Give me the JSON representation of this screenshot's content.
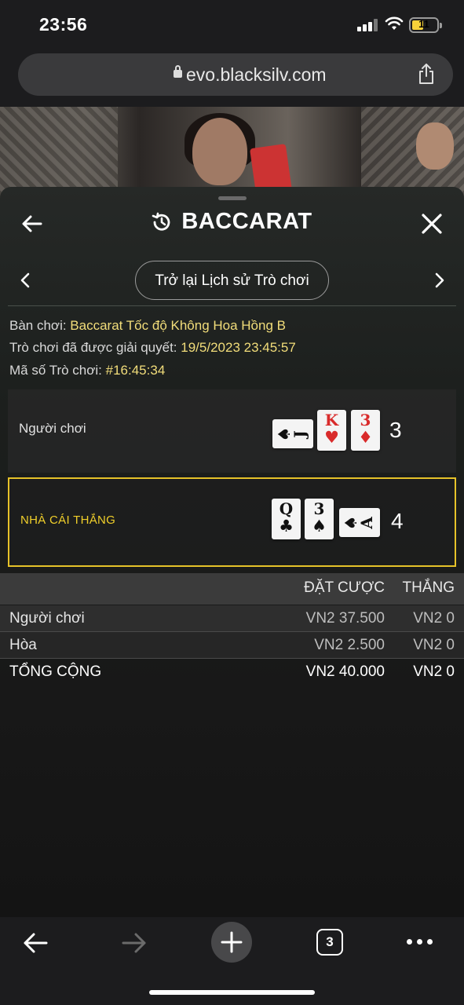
{
  "status_bar": {
    "time": "23:56",
    "battery": "11"
  },
  "browser": {
    "url": "evo.blacksilv.com",
    "open_tabs": "3"
  },
  "header": {
    "title": "BACCARAT"
  },
  "nav": {
    "back_to_history": "Trở lại Lịch sử Trò chơi"
  },
  "game_info": {
    "table_label": "Bàn chơi: ",
    "table_value": "Baccarat Tốc độ Không Hoa Hồng B",
    "resolved_label": "Trò chơi đã được giải quyết: ",
    "resolved_value": "19/5/2023 23:45:57",
    "id_label": "Mã số Trò chơi: ",
    "id_value": "#16:45:34"
  },
  "player_hand": {
    "label": "Người chơi",
    "score": "3",
    "cards": [
      {
        "rank": "J",
        "suit": "♠",
        "color": "#111111"
      },
      {
        "rank": "K",
        "suit": "♥",
        "color": "#d92b2b"
      },
      {
        "rank": "3",
        "suit": "♦",
        "color": "#d92b2b"
      }
    ]
  },
  "banker_hand": {
    "label": "NHÀ CÁI THẮNG",
    "score": "4",
    "cards": [
      {
        "rank": "Q",
        "suit": "♣",
        "color": "#111111"
      },
      {
        "rank": "3",
        "suit": "♠",
        "color": "#111111"
      },
      {
        "rank": "A",
        "suit": "♠",
        "color": "#111111"
      }
    ]
  },
  "bets": {
    "col_bet": "ĐẶT CƯỢC",
    "col_win": "THẮNG",
    "rows": [
      {
        "name": "Người chơi",
        "bet": "VN2 37.500",
        "win": "VN2 0"
      },
      {
        "name": "Hòa",
        "bet": "VN2 2.500",
        "win": "VN2 0"
      },
      {
        "name": "TỔNG CỘNG",
        "bet": "VN2 40.000",
        "win": "VN2 0"
      }
    ]
  },
  "colors": {
    "accent": "#e6c229",
    "info_value": "#f2dd7a"
  }
}
